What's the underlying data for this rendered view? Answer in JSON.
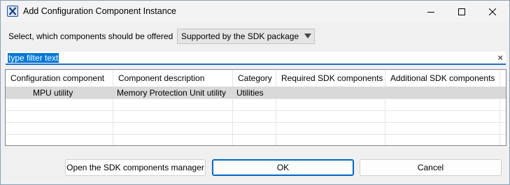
{
  "window": {
    "title": "Add Configuration Component Instance",
    "icon": "x-box-icon",
    "accent": "#1a4fa0"
  },
  "selector": {
    "label": "Select, which components should be offered",
    "value": "Supported by the SDK package"
  },
  "filter": {
    "value": "type filter text",
    "clear_glyph": "×"
  },
  "table": {
    "columns": [
      "Configuration component",
      "Component description",
      "Category",
      "Required SDK components",
      "Additional SDK components"
    ],
    "rows": [
      {
        "component": "MPU utility",
        "description": "Memory Protection Unit utility",
        "category": "Utilities",
        "required": "",
        "additional": ""
      }
    ]
  },
  "buttons": {
    "manager": "Open the SDK components manager",
    "ok": "OK",
    "cancel": "Cancel"
  },
  "colors": {
    "selection": "#0078d7",
    "focus_border": "#0067c0",
    "row_selected": "#d9d9d9"
  }
}
